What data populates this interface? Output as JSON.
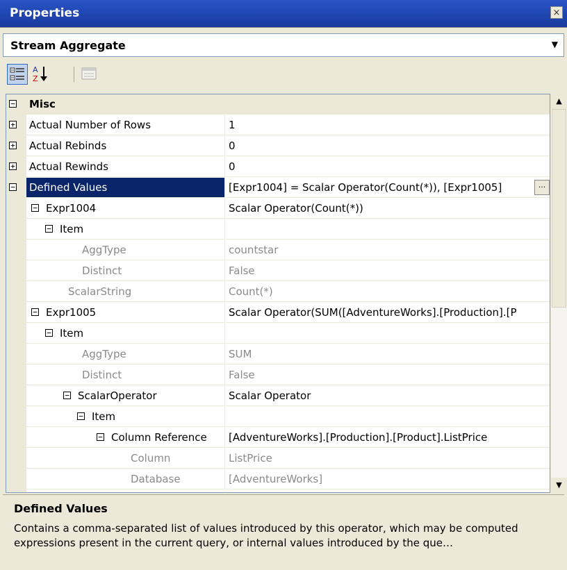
{
  "window": {
    "title": "Properties",
    "close_glyph": "×"
  },
  "object_selector": {
    "value": "Stream Aggregate"
  },
  "toolbar": {
    "categorized_icon": "categorized-icon",
    "alphabetical_icon": "sort-az-icon",
    "property_pages_icon": "property-pages-icon"
  },
  "category": {
    "label": "Misc"
  },
  "rows": [
    {
      "name": "Actual Number of Rows",
      "value": "1"
    },
    {
      "name": "Actual Rebinds",
      "value": "0"
    },
    {
      "name": "Actual Rewinds",
      "value": "0"
    },
    {
      "name": "Defined Values",
      "value": "[Expr1004] = Scalar Operator(Count(*)), [Expr1005]"
    },
    {
      "name": "Expr1004",
      "value": "Scalar Operator(Count(*))"
    },
    {
      "name": "Item",
      "value": ""
    },
    {
      "name": "AggType",
      "value": "countstar"
    },
    {
      "name": "Distinct",
      "value": "False"
    },
    {
      "name": "ScalarString",
      "value": "Count(*)"
    },
    {
      "name": "Expr1005",
      "value": "Scalar Operator(SUM([AdventureWorks].[Production].[P"
    },
    {
      "name": "Item",
      "value": ""
    },
    {
      "name": "AggType",
      "value": "SUM"
    },
    {
      "name": "Distinct",
      "value": "False"
    },
    {
      "name": "ScalarOperator",
      "value": "Scalar Operator"
    },
    {
      "name": "Item",
      "value": ""
    },
    {
      "name": "Column Reference",
      "value": "[AdventureWorks].[Production].[Product].ListPrice"
    },
    {
      "name": "Column",
      "value": "ListPrice"
    },
    {
      "name": "Database",
      "value": "[AdventureWorks]"
    }
  ],
  "description": {
    "title": "Defined Values",
    "text": "Contains a comma-separated list of values introduced by this operator, which may be computed expressions present in the current query, or internal values introduced by the que…"
  },
  "colors": {
    "selection": "#0a246a",
    "titlebar": "#1f46b0",
    "dim_text": "#8a8a8a"
  }
}
